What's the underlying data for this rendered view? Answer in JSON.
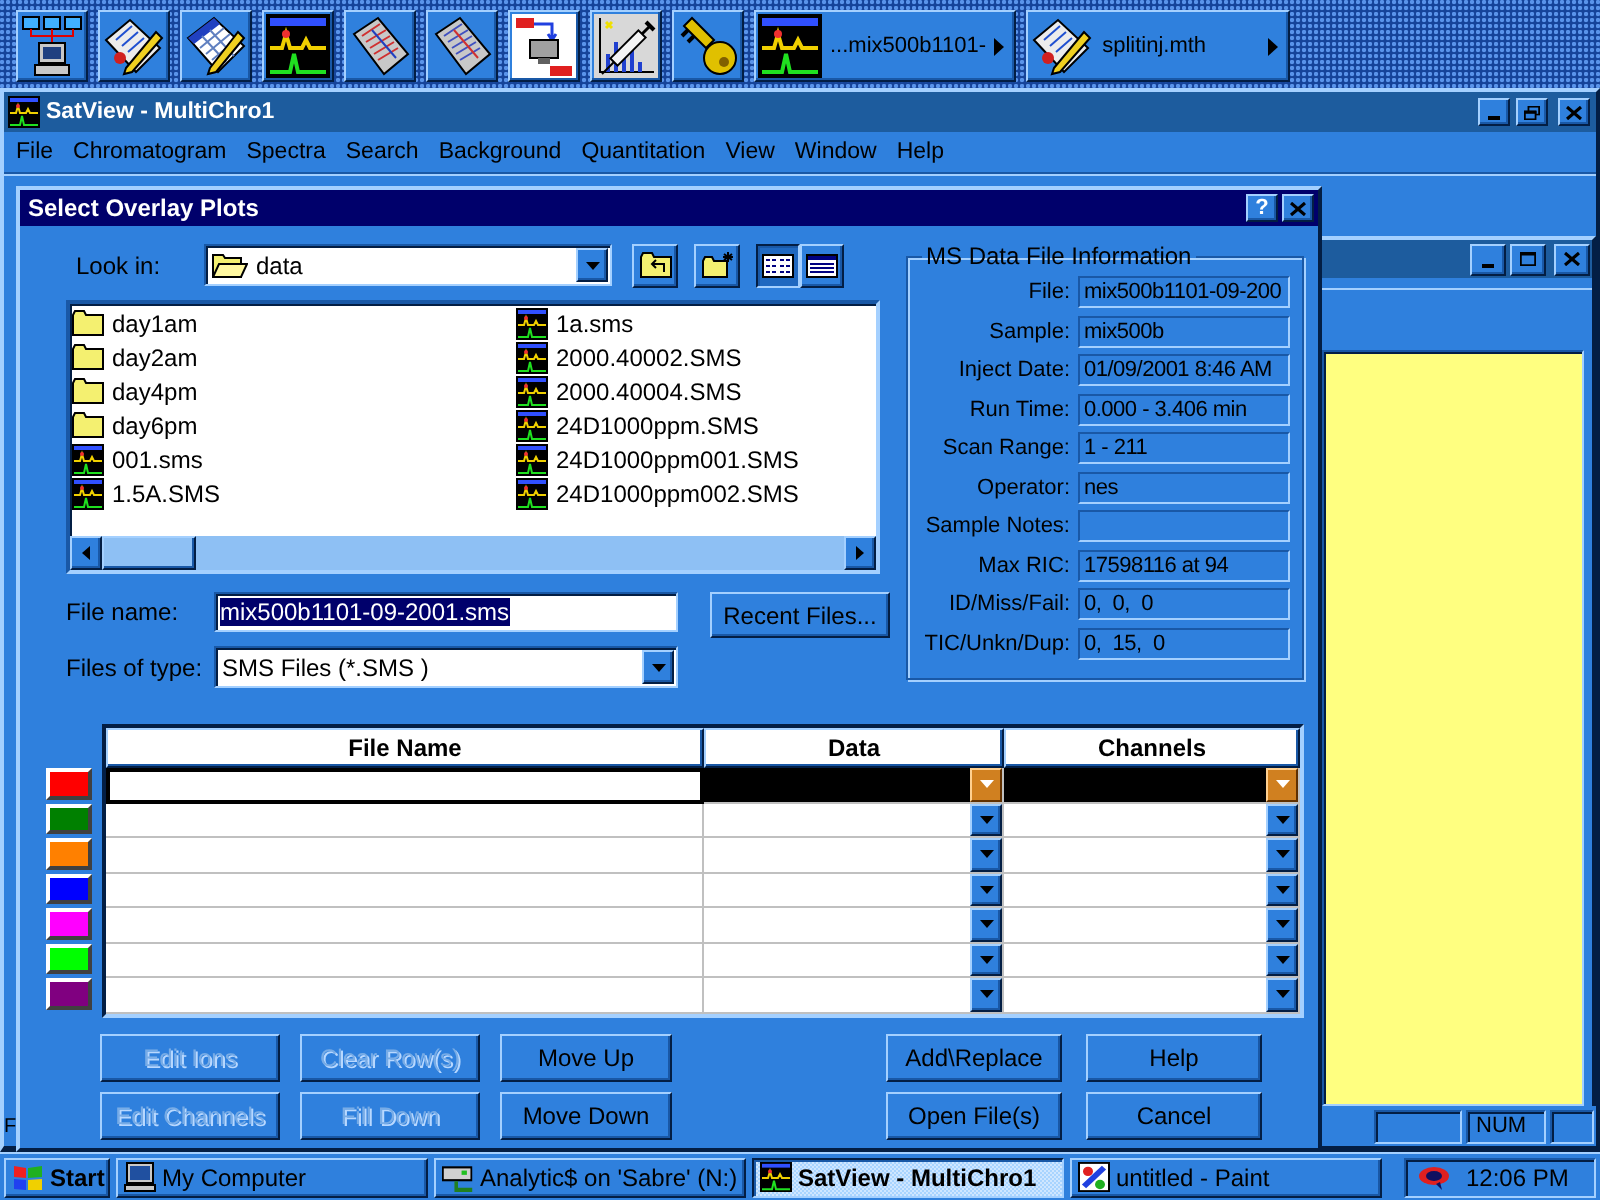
{
  "toolbar": {
    "tasks": [
      {
        "label": "...mix500b1101-"
      },
      {
        "label": "splitinj.mth"
      }
    ]
  },
  "app_window": {
    "title": "SatView - MultiChro1",
    "menu": [
      "File",
      "Chromatogram",
      "Spectra",
      "Search",
      "Background",
      "Quantitation",
      "View",
      "Window",
      "Help"
    ],
    "status_bar": {
      "text": "F",
      "panels": [
        "NUM"
      ]
    }
  },
  "dialog": {
    "title": "Select Overlay Plots",
    "help_button": "?",
    "look_in": {
      "label": "Look in:",
      "value": "data"
    },
    "view_buttons": [
      {
        "selected": true
      },
      {
        "selected": false
      }
    ],
    "files": [
      {
        "name": "day1am",
        "kind": "folder"
      },
      {
        "name": "day2am",
        "kind": "folder"
      },
      {
        "name": "day4pm",
        "kind": "folder"
      },
      {
        "name": "day6pm",
        "kind": "folder"
      },
      {
        "name": "001.sms",
        "kind": "file"
      },
      {
        "name": "1.5A.SMS",
        "kind": "file"
      },
      {
        "name": "1a.sms",
        "kind": "file"
      },
      {
        "name": "2000.40002.SMS",
        "kind": "file"
      },
      {
        "name": "2000.40004.SMS",
        "kind": "file"
      },
      {
        "name": "24D1000ppm.SMS",
        "kind": "file"
      },
      {
        "name": "24D1000ppm001.SMS",
        "kind": "file"
      },
      {
        "name": "24D1000ppm002.SMS",
        "kind": "file"
      }
    ],
    "file_name": {
      "label": "File name:",
      "value": "mix500b1101-09-2001.sms",
      "highlighted": true
    },
    "recent_button": "Recent Files...",
    "file_type": {
      "label": "Files of type:",
      "value": "SMS Files (*.SMS )"
    },
    "info": {
      "title": "MS Data File Information",
      "fields": [
        {
          "label": "File:",
          "value": "mix500b1101-09-200"
        },
        {
          "label": "Sample:",
          "value": "mix500b"
        },
        {
          "label": "Inject Date:",
          "value": "01/09/2001 8:46 AM"
        },
        {
          "label": "Run Time:",
          "value": "0.000 - 3.406 min"
        },
        {
          "label": "Scan Range:",
          "value": "1 - 211"
        },
        {
          "label": "Operator:",
          "value": "nes"
        },
        {
          "label": "Sample Notes:"
        },
        {
          "label": "Max RIC:",
          "value": "17598116 at 94"
        },
        {
          "label": "ID/Miss/Fail:",
          "value": "0,  0,  0"
        },
        {
          "label": "TIC/Unkn/Dup:",
          "value": "0,  15,  0"
        }
      ]
    },
    "grid": {
      "columns": [
        "File Name",
        "Data",
        "Channels"
      ],
      "rows": [
        {
          "color": "#ff0000",
          "selected": true
        },
        {
          "color": "#008000",
          "selected": false
        },
        {
          "color": "#ff8000",
          "selected": false
        },
        {
          "color": "#0000ff",
          "selected": false
        },
        {
          "color": "#ff00ff",
          "selected": false
        },
        {
          "color": "#00ff00",
          "selected": false
        },
        {
          "color": "#800080",
          "selected": false
        }
      ]
    },
    "edit_buttons": [
      {
        "label": "Edit Ions",
        "disabled": true
      },
      {
        "label": "Clear Row(s)",
        "disabled": true
      },
      {
        "label": "Move Up",
        "disabled": false
      },
      {
        "label": "Edit Channels",
        "disabled": true
      },
      {
        "label": "Fill Down",
        "disabled": true
      },
      {
        "label": "Move Down",
        "disabled": false
      }
    ],
    "action_buttons": [
      {
        "label": "Add\\Replace"
      },
      {
        "label": "Help"
      },
      {
        "label": "Open File(s)"
      },
      {
        "label": "Cancel"
      }
    ]
  },
  "taskbar": {
    "start": "Start",
    "tasks": [
      {
        "label": "My Computer",
        "selected": false
      },
      {
        "label": "Analytic$ on 'Sabre' (N:)",
        "selected": false
      },
      {
        "label": "SatView - MultiChro1",
        "selected": true
      },
      {
        "label": "untitled - Paint",
        "selected": false
      }
    ],
    "clock": "12:06 PM"
  }
}
